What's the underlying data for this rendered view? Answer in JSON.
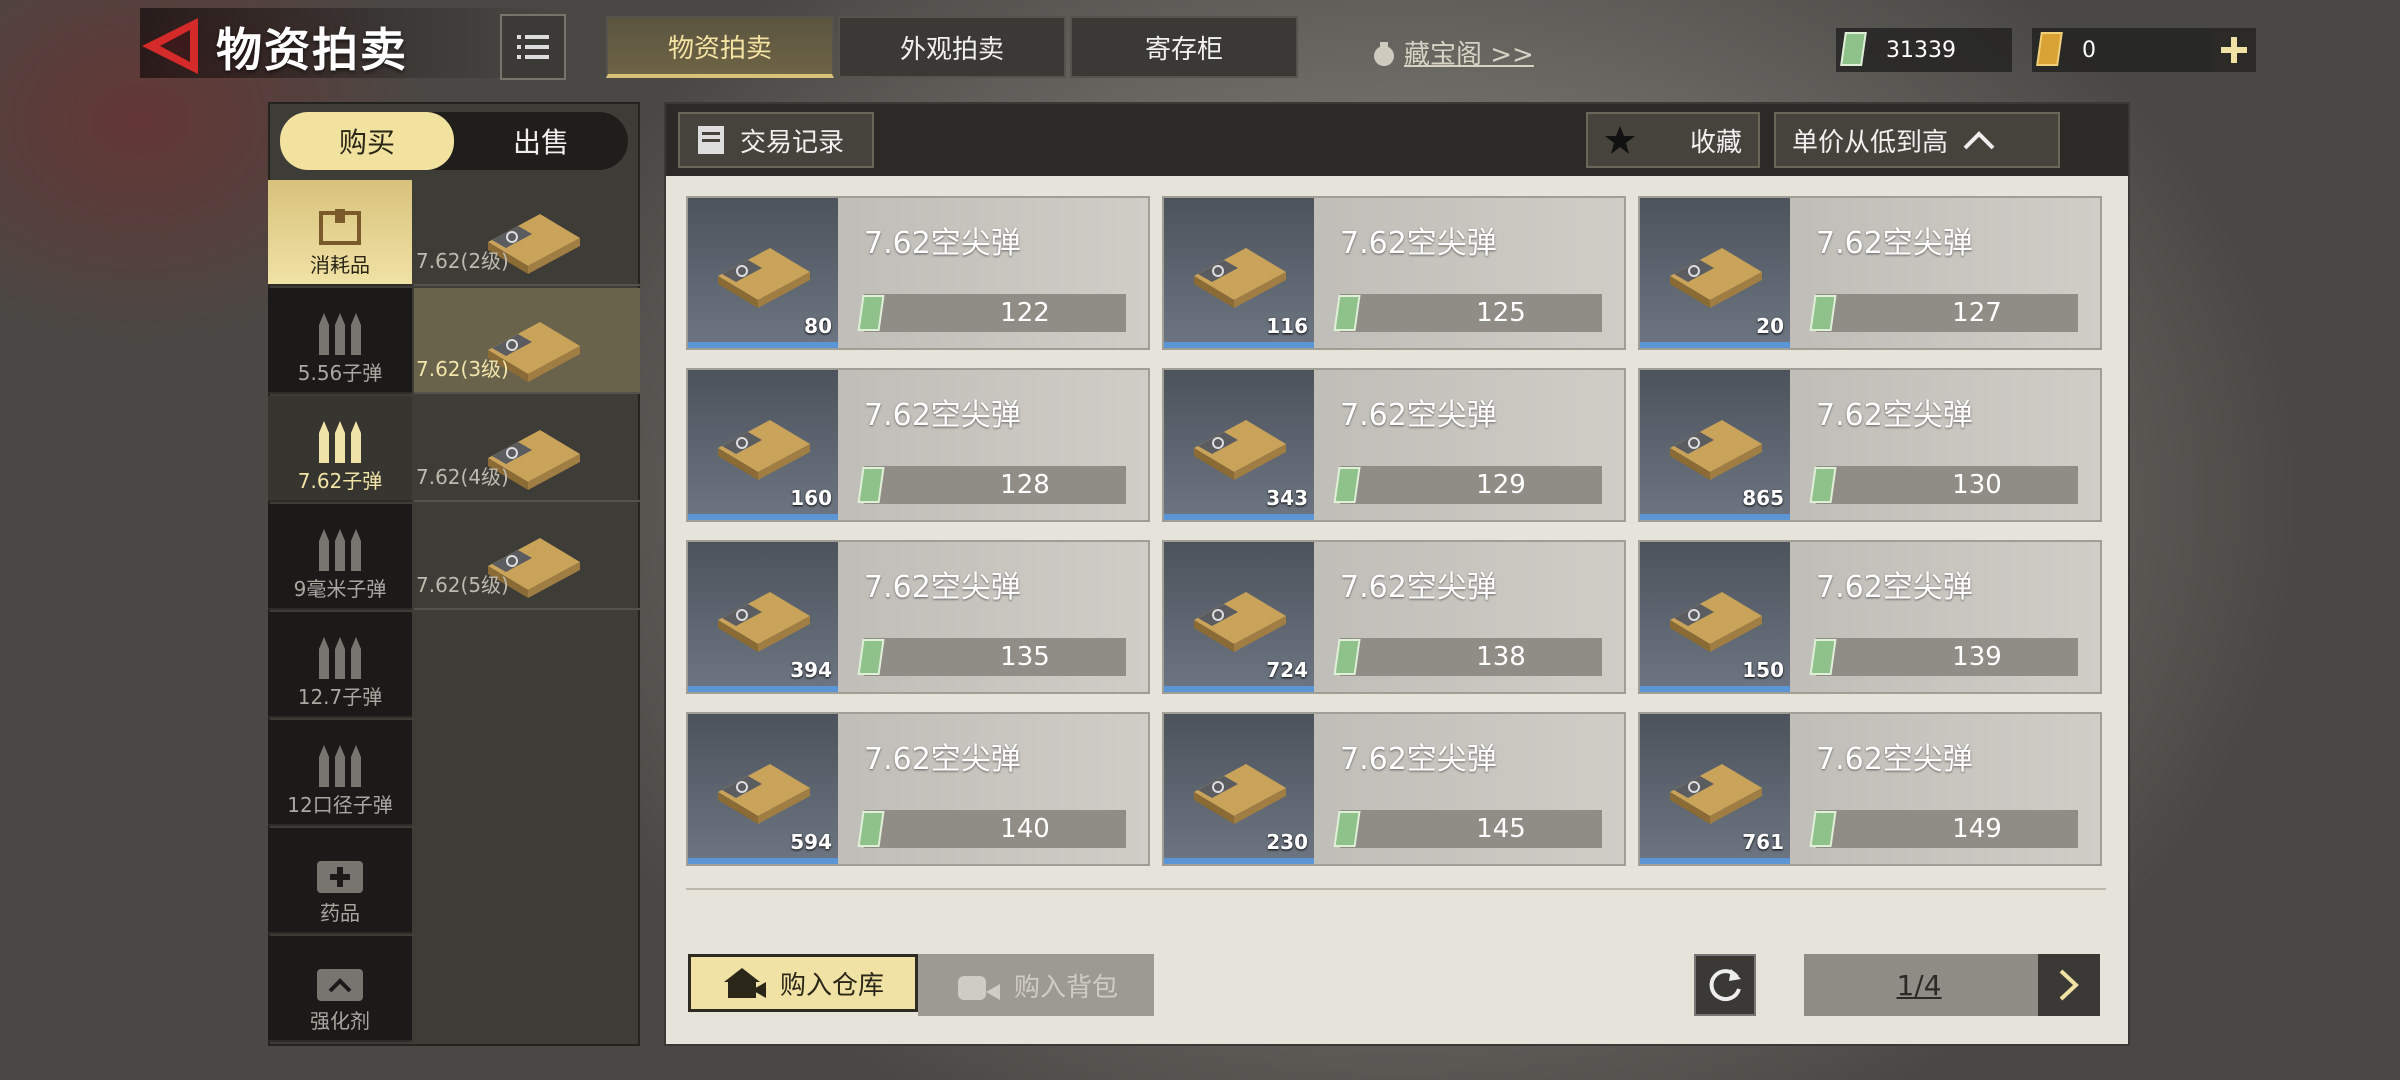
{
  "header": {
    "title": "物资拍卖",
    "tabs": [
      {
        "label": "物资拍卖",
        "active": true
      },
      {
        "label": "外观拍卖",
        "active": false
      },
      {
        "label": "寄存柜",
        "active": false
      }
    ],
    "treasure_link": "藏宝阁 >>",
    "currency_cash": "31339",
    "currency_ticket": "0"
  },
  "mode": {
    "buy": "购买",
    "sell": "出售",
    "active": "buy"
  },
  "categories": [
    {
      "label": "消耗品",
      "icon": "crate-icon",
      "state": "active"
    },
    {
      "label": "5.56子弹",
      "icon": "bullets-icon",
      "state": "normal"
    },
    {
      "label": "7.62子弹",
      "icon": "bullets-icon",
      "state": "selected"
    },
    {
      "label": "9毫米子弹",
      "icon": "bullets-icon",
      "state": "normal"
    },
    {
      "label": "12.7子弹",
      "icon": "bullets-icon",
      "state": "normal"
    },
    {
      "label": "12口径子弹",
      "icon": "bullets-icon",
      "state": "normal"
    },
    {
      "label": "药品",
      "icon": "medkit-icon",
      "state": "normal"
    },
    {
      "label": "强化剂",
      "icon": "booster-icon",
      "state": "normal"
    }
  ],
  "subcategories": [
    {
      "label": "7.62(2级)",
      "active": false
    },
    {
      "label": "7.62(3级)",
      "active": true
    },
    {
      "label": "7.62(4级)",
      "active": false
    },
    {
      "label": "7.62(5级)",
      "active": false
    }
  ],
  "toolbar": {
    "trade_record": "交易记录",
    "favorites": "收藏",
    "sort": "单价从低到高"
  },
  "items": [
    {
      "name": "7.62空尖弹",
      "qty": "80",
      "price": "122"
    },
    {
      "name": "7.62空尖弹",
      "qty": "116",
      "price": "125"
    },
    {
      "name": "7.62空尖弹",
      "qty": "20",
      "price": "127"
    },
    {
      "name": "7.62空尖弹",
      "qty": "160",
      "price": "128"
    },
    {
      "name": "7.62空尖弹",
      "qty": "343",
      "price": "129"
    },
    {
      "name": "7.62空尖弹",
      "qty": "865",
      "price": "130"
    },
    {
      "name": "7.62空尖弹",
      "qty": "394",
      "price": "135"
    },
    {
      "name": "7.62空尖弹",
      "qty": "724",
      "price": "138"
    },
    {
      "name": "7.62空尖弹",
      "qty": "150",
      "price": "139"
    },
    {
      "name": "7.62空尖弹",
      "qty": "594",
      "price": "140"
    },
    {
      "name": "7.62空尖弹",
      "qty": "230",
      "price": "145"
    },
    {
      "name": "7.62空尖弹",
      "qty": "761",
      "price": "149"
    }
  ],
  "footer": {
    "buy_storage": "购入仓库",
    "buy_bag": "购入背包",
    "page": "1/4"
  },
  "colors": {
    "accent": "#f0e2a4",
    "selected_blue": "#5a95d6",
    "dark": "#2b2a27"
  }
}
